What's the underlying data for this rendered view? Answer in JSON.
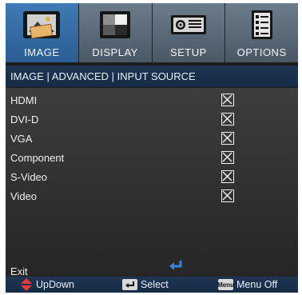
{
  "tabs": [
    {
      "label": "IMAGE",
      "icon": "image-icon",
      "active": true
    },
    {
      "label": "DISPLAY",
      "icon": "display-icon",
      "active": false
    },
    {
      "label": "SETUP",
      "icon": "projector-icon",
      "active": false
    },
    {
      "label": "OPTIONS",
      "icon": "options-icon",
      "active": false
    }
  ],
  "breadcrumb": "IMAGE | ADVANCED | INPUT SOURCE",
  "sources": [
    {
      "label": "HDMI",
      "checked": true
    },
    {
      "label": "DVI-D",
      "checked": true
    },
    {
      "label": "VGA",
      "checked": true
    },
    {
      "label": "Component",
      "checked": true
    },
    {
      "label": "S-Video",
      "checked": true
    },
    {
      "label": "Video",
      "checked": true
    }
  ],
  "exit_label": "Exit",
  "footer": {
    "updown_label": "UpDown",
    "select_label": "Select",
    "menu_key": "Menu",
    "menu_off_label": "Menu Off"
  },
  "colors": {
    "active_tab": "#3f7bb5",
    "inactive_tab": "#5c6b79",
    "header_bar": "#1f3552",
    "accent_red": "#e23b3b",
    "accent_blue": "#3b7fd8"
  }
}
